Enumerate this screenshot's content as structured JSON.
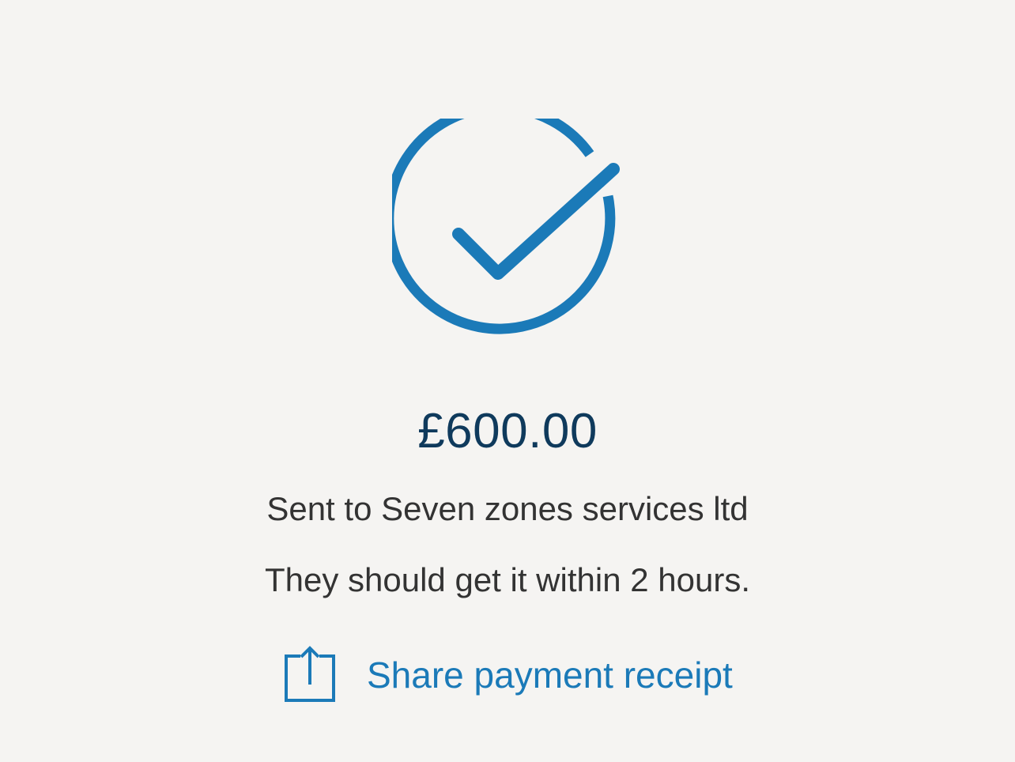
{
  "colors": {
    "background": "#f5f4f2",
    "accent": "#1b7ab8",
    "amount_text": "#0f3a5c",
    "body_text": "#333333"
  },
  "status_icon": "check-circle-icon",
  "payment": {
    "amount": "£600.00",
    "recipient_text": "Sent to Seven zones services ltd",
    "eta_text": "They should get it within 2 hours."
  },
  "share": {
    "icon": "share-icon",
    "label": "Share payment receipt"
  }
}
